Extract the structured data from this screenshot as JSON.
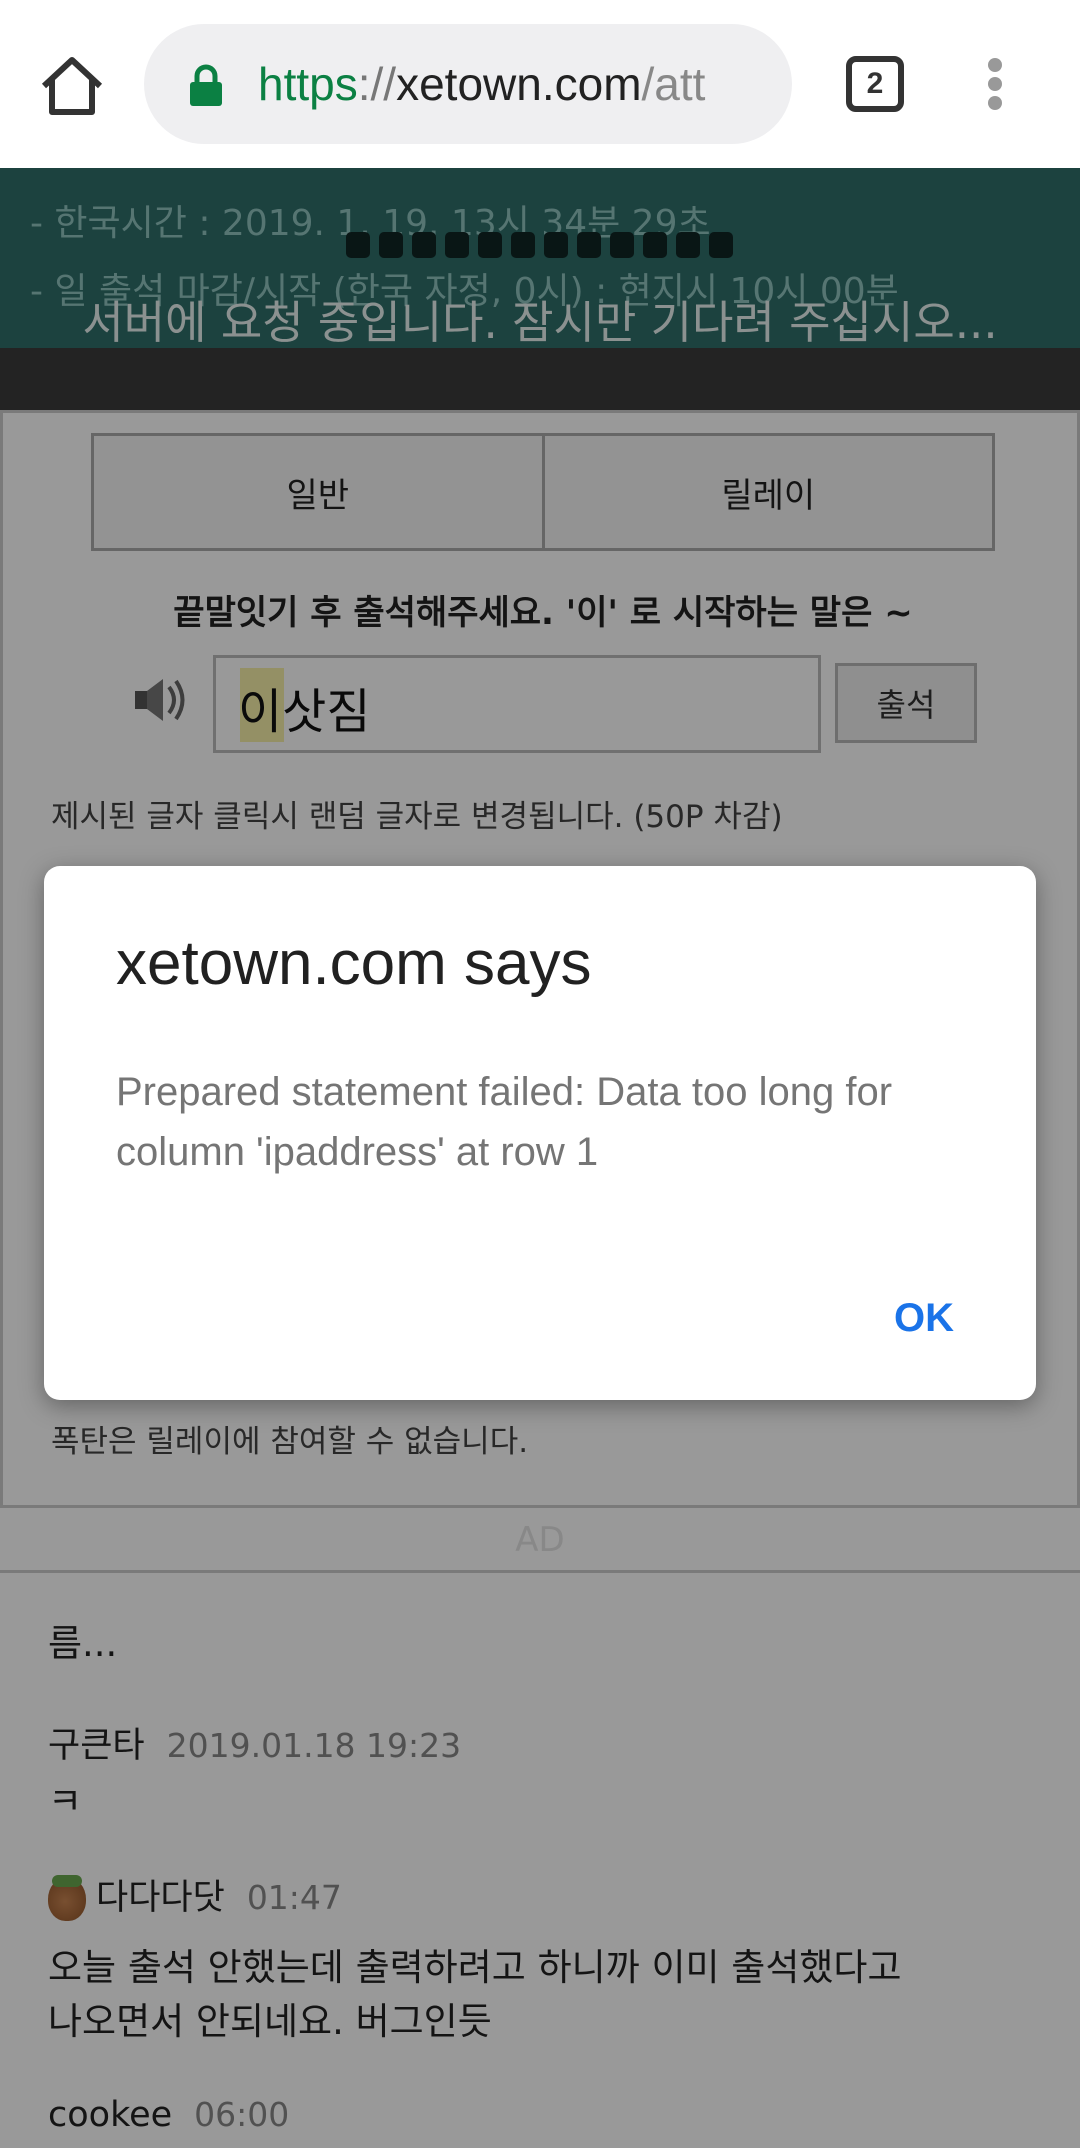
{
  "browser": {
    "url_scheme": "https",
    "url_sep": "://",
    "url_host": "xetown.com",
    "url_path": "/att",
    "tab_count": "2",
    "icons": {
      "home": "home-icon",
      "lock": "lock-icon",
      "menu": "overflow-menu-icon"
    },
    "colors": {
      "secure": "#0b8043"
    }
  },
  "banner": {
    "line1": "- 한국시간 : 2019. 1. 19. 13시 34분 29초",
    "line2": "- 일 출석 마감/시작 (한국 자정, 0시) : 현지시 10시 00분",
    "loading": "서버에 요청 중입니다. 잠시만 기다려 주십시오...",
    "color": "#2f6e6a"
  },
  "attendance": {
    "tabs": [
      {
        "label": "일반"
      },
      {
        "label": "릴레이"
      }
    ],
    "prompt": "끝말잇기 후 출석해주세요. '이' 로 시작하는 말은 ~",
    "answer": "이삿짐",
    "submit_label": "출석",
    "note1": "제시된 글자 클릭시 랜덤 글자로 변경됩니다. (50P 차감)",
    "note2": "폭탄은 릴레이에 참여할 수 없습니다."
  },
  "ad_label": "AD",
  "comments": [
    {
      "text": "름..."
    },
    {
      "author": "구큰타",
      "time": "2019.01.18 19:23",
      "text": "ㅋ"
    },
    {
      "author": "다다다닷",
      "time": "01:47",
      "text_line1": "오늘 출석 안했는데 출력하려고 하니까 이미 출석했다고",
      "text_line2": "나오면서 안되네요. 버그인듯"
    },
    {
      "author": "cookee",
      "time": "06:00"
    }
  ],
  "dialog": {
    "title": "xetown.com says",
    "message": "Prepared statement failed: Data too long for column 'ipaddress' at row 1",
    "ok_label": "OK",
    "accent": "#1a73e8"
  }
}
